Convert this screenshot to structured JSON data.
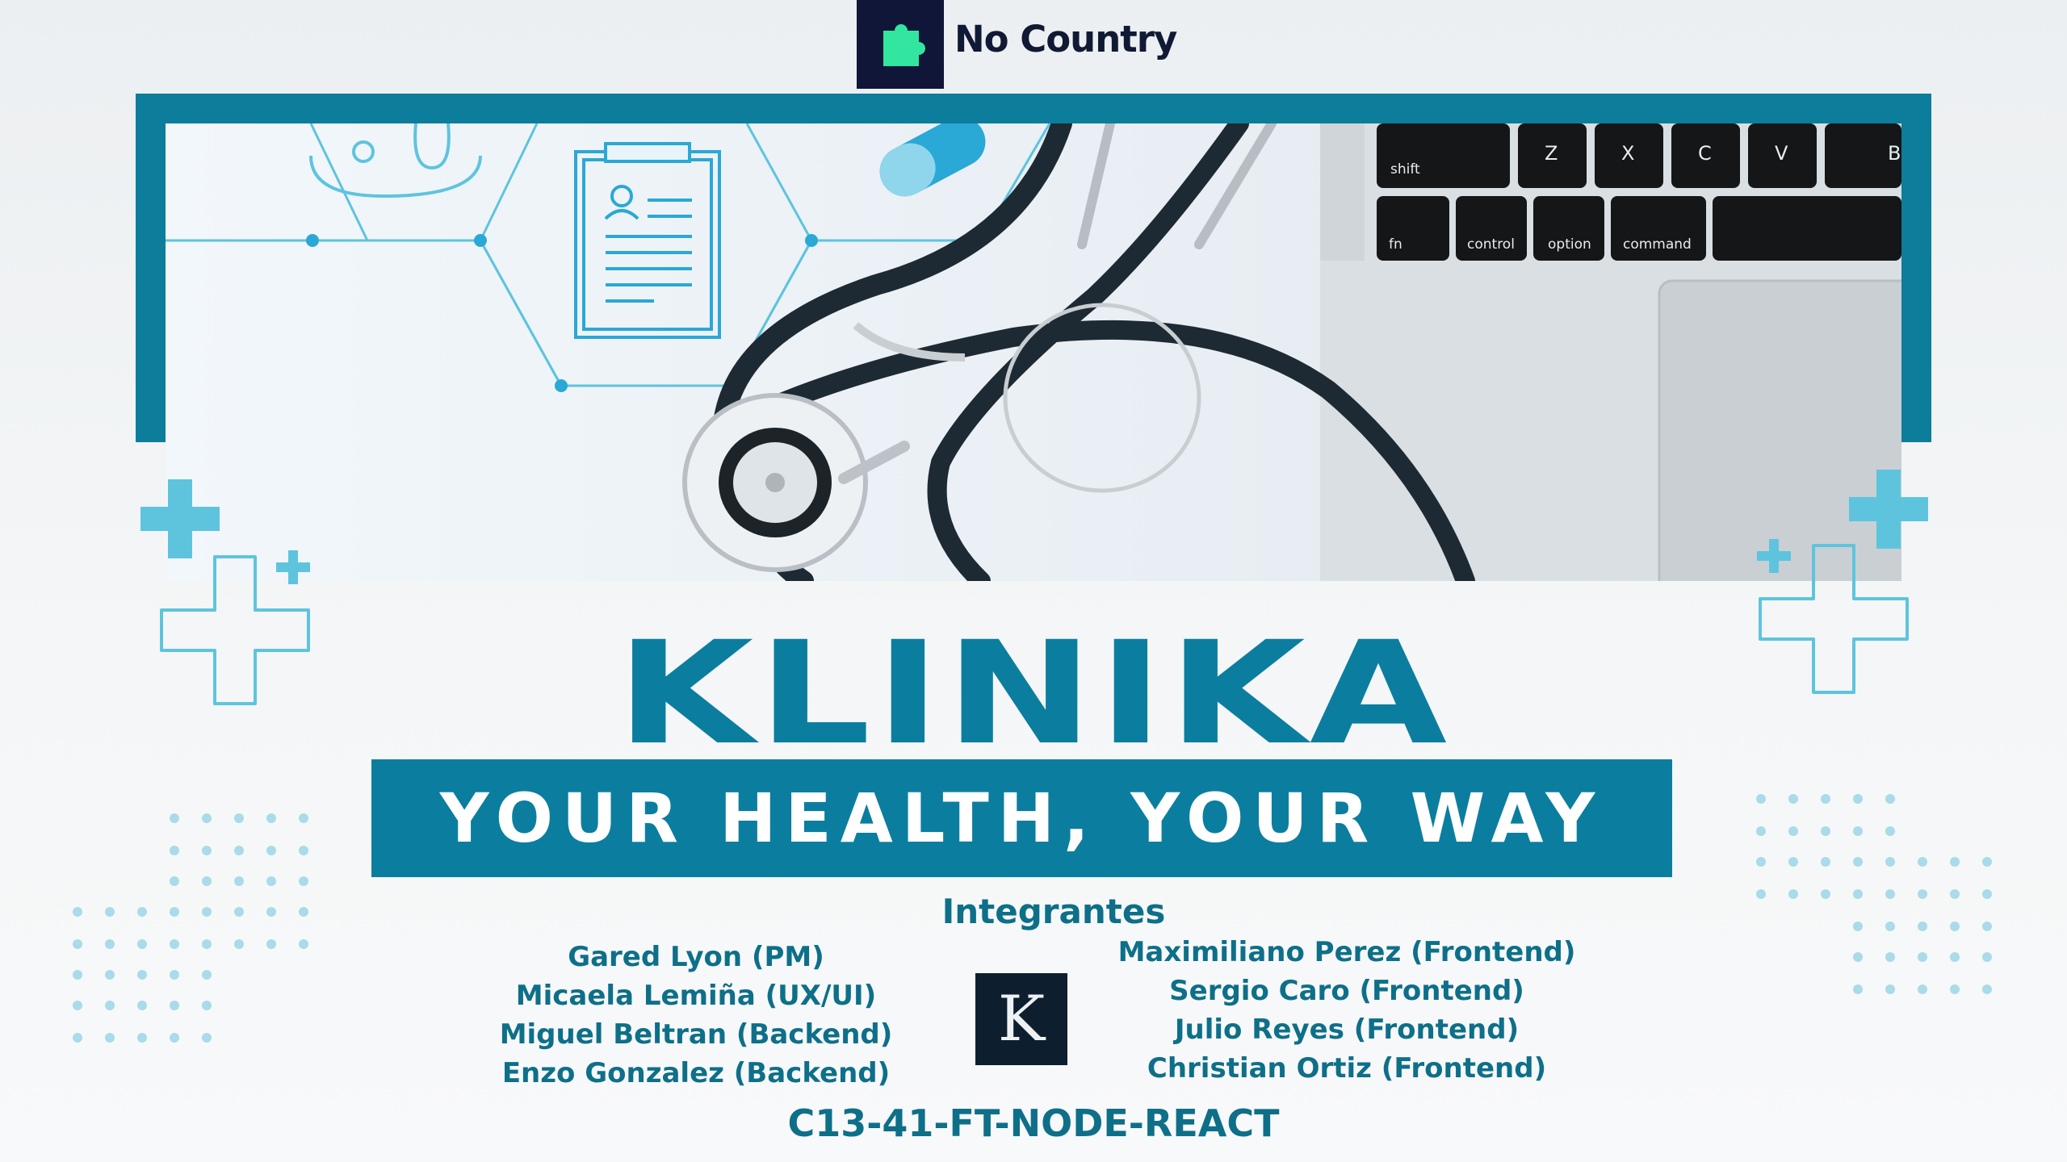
{
  "header": {
    "brand_name": "No Country",
    "brand_icon": "puzzle-piece-icon",
    "brand_colors": {
      "box": "#0f1638",
      "icon": "#32e6a0"
    }
  },
  "banner": {
    "description_icons": [
      "stethoscope-icon",
      "clipboard-icon",
      "pill-icon",
      "hexagon-network-icon"
    ],
    "keyboard_keys": [
      "shift",
      "Z",
      "X",
      "C",
      "V",
      "B",
      "fn",
      "control",
      "option",
      "command"
    ]
  },
  "title": {
    "main": "KLINIKA",
    "tagline": "YOUR HEALTH, YOUR WAY"
  },
  "team": {
    "heading": "Integrantes",
    "left": [
      "Gared Lyon (PM)",
      "Micaela Lemiña (UX/UI)",
      "Miguel Beltran (Backend)",
      "Enzo Gonzalez (Backend)"
    ],
    "right": [
      "Maximiliano Perez (Frontend)",
      "Sergio Caro (Frontend)",
      "Julio Reyes (Frontend)",
      "Christian Ortiz (Frontend)"
    ],
    "logo_letter": "K"
  },
  "footer": {
    "project_code": "C13-41-FT-NODE-REACT"
  },
  "colors": {
    "accent": "#0b7e9f",
    "accent_light": "#5ec4de",
    "text_teal": "#0e6f89",
    "background": "#eceff1"
  }
}
